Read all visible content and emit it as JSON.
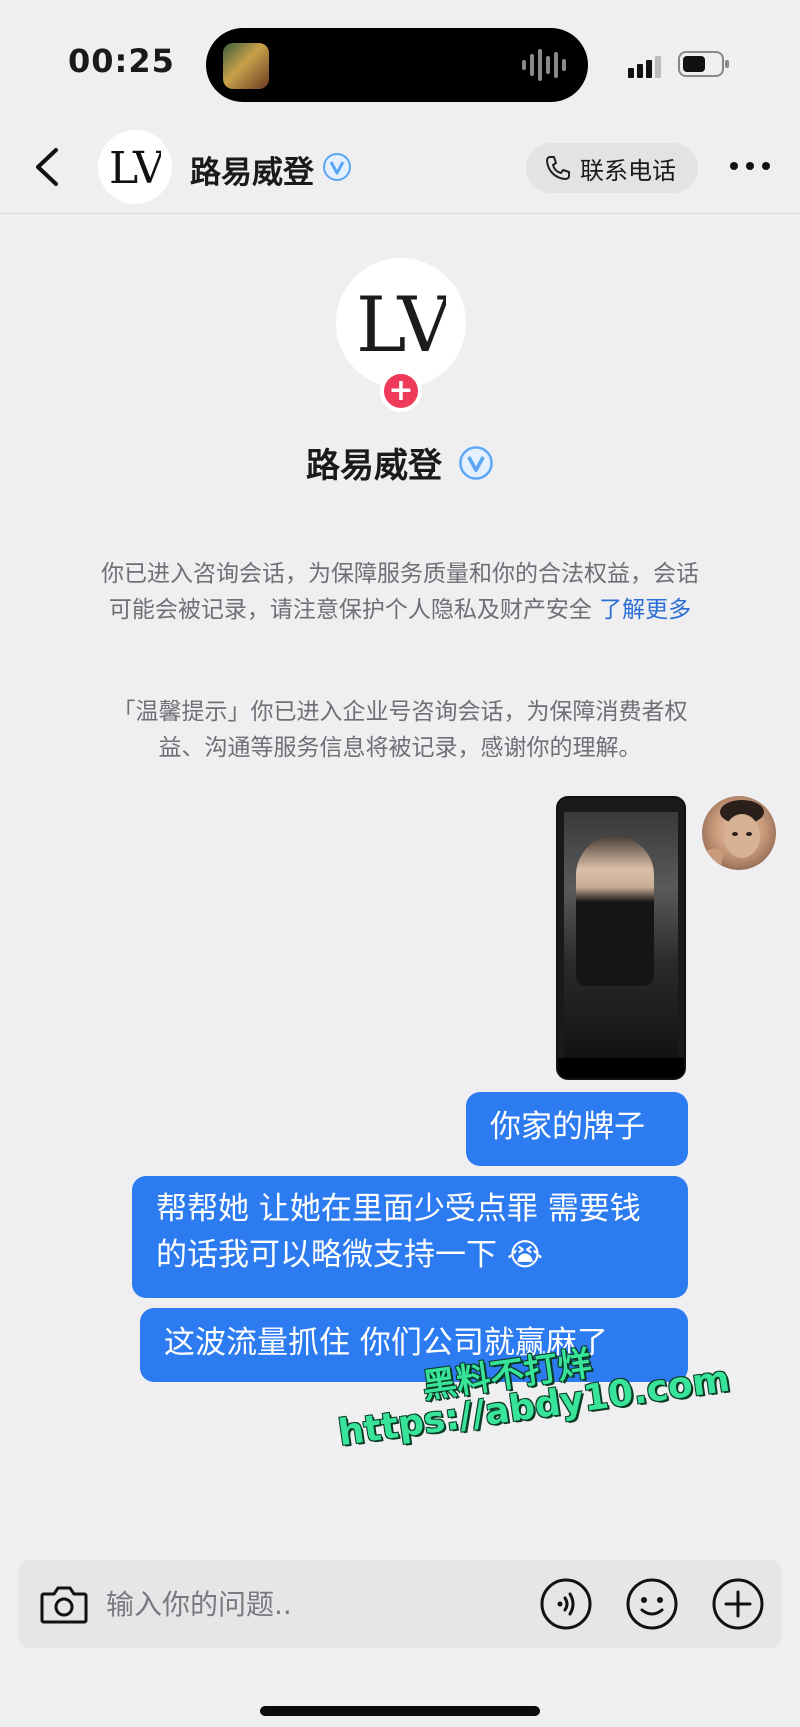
{
  "status_bar": {
    "time": "00:25"
  },
  "header": {
    "title": "路易威登",
    "call_label": "联系电话",
    "brand_logo_text": "LV"
  },
  "profile": {
    "name": "路易威登"
  },
  "notices": {
    "notice_1": "你已进入咨询会话，为保障服务质量和你的合法权益，会话可能会被记录，请注意保护个人隐私及财产安全",
    "notice_1_link": "了解更多",
    "notice_2": "「温馨提示」你已进入企业号咨询会话，为保障消费者权益、沟通等服务信息将被记录，感谢你的理解。"
  },
  "messages": [
    {
      "text": "你家的牌子"
    },
    {
      "text": "帮帮她 让她在里面少受点罪 需要钱的话我可以略微支持一下 😭"
    },
    {
      "text": "这波流量抓住 你们公司就赢麻了"
    }
  ],
  "watermark": {
    "line1": "黑料不打烊",
    "line2": "https://abdy10.com"
  },
  "input": {
    "placeholder": "输入你的问题.."
  },
  "colors": {
    "bubble": "#2d7bf0",
    "link": "#2b6fd6",
    "follow_badge": "#f03a5a",
    "watermark": "#38e39a"
  }
}
